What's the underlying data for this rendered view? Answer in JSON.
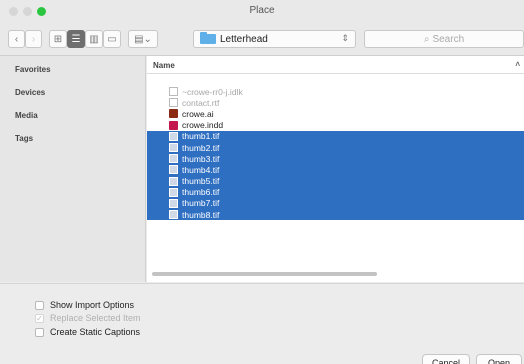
{
  "window": {
    "title": "Place"
  },
  "toolbar": {
    "location": "Letterhead",
    "search_placeholder": "Search"
  },
  "sidebar": {
    "items": [
      {
        "label": "Favorites"
      },
      {
        "label": "Devices"
      },
      {
        "label": "Media"
      },
      {
        "label": "Tags"
      }
    ]
  },
  "filelist": {
    "column_name": "Name",
    "files": [
      {
        "name": "~crowe-rr0-j.idlk",
        "icon": "document-icon",
        "state": "dimmed"
      },
      {
        "name": "contact.rtf",
        "icon": "document-icon",
        "state": "dimmed"
      },
      {
        "name": "crowe.ai",
        "icon": "illustrator-icon",
        "state": "normal"
      },
      {
        "name": "crowe.indd",
        "icon": "indesign-icon",
        "state": "normal"
      },
      {
        "name": "thumb1.tif",
        "icon": "image-icon",
        "state": "selected"
      },
      {
        "name": "thumb2.tif",
        "icon": "image-icon",
        "state": "selected"
      },
      {
        "name": "thumb3.tif",
        "icon": "image-icon",
        "state": "selected"
      },
      {
        "name": "thumb4.tif",
        "icon": "image-icon",
        "state": "selected"
      },
      {
        "name": "thumb5.tif",
        "icon": "image-icon",
        "state": "selected"
      },
      {
        "name": "thumb6.tif",
        "icon": "image-icon",
        "state": "selected"
      },
      {
        "name": "thumb7.tif",
        "icon": "image-icon",
        "state": "selected"
      },
      {
        "name": "thumb8.tif",
        "icon": "image-icon",
        "state": "selected"
      }
    ]
  },
  "options": {
    "show_import": {
      "label": "Show Import Options",
      "checked": false
    },
    "replace_selected": {
      "label": "Replace Selected Item",
      "checked": true,
      "disabled": true
    },
    "static_captions": {
      "label": "Create Static Captions",
      "checked": false
    }
  },
  "buttons": {
    "cancel": "Cancel",
    "open": "Open"
  },
  "colors": {
    "selection": "#2f6fc2",
    "folder": "#5fb0e8"
  }
}
